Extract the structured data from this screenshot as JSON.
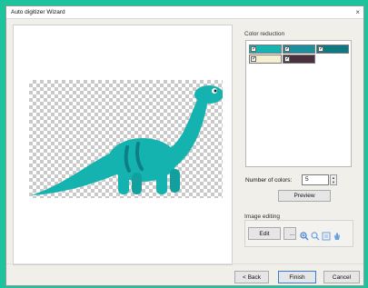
{
  "window": {
    "title": "Auto digitizer Wizard",
    "close_glyph": "×"
  },
  "color_reduction": {
    "label": "Color reduction",
    "swatches": [
      {
        "color": "#17b3b0",
        "checked": "✓"
      },
      {
        "color": "#1b8f9c",
        "checked": "✓"
      },
      {
        "color": "#0e7980",
        "checked": "✓"
      },
      {
        "color": "#f3efcf",
        "checked": "✓"
      },
      {
        "color": "#4a2f3f",
        "checked": "✓"
      }
    ]
  },
  "number_of_colors": {
    "label": "Number of colors:",
    "value": "5"
  },
  "preview_button": "Preview",
  "image_editing": {
    "label": "Image editing",
    "edit_button": "Edit",
    "more_button": "...",
    "tools": [
      "zoom-in-icon",
      "zoom-out-icon",
      "fit-icon",
      "hand-icon"
    ]
  },
  "footer": {
    "back": "< Back",
    "finish": "Finish",
    "cancel": "Cancel"
  },
  "colors": {
    "dino_main": "#15b3b0",
    "dino_stripe": "#0f7f86",
    "dino_belly": "#f3efcf"
  }
}
